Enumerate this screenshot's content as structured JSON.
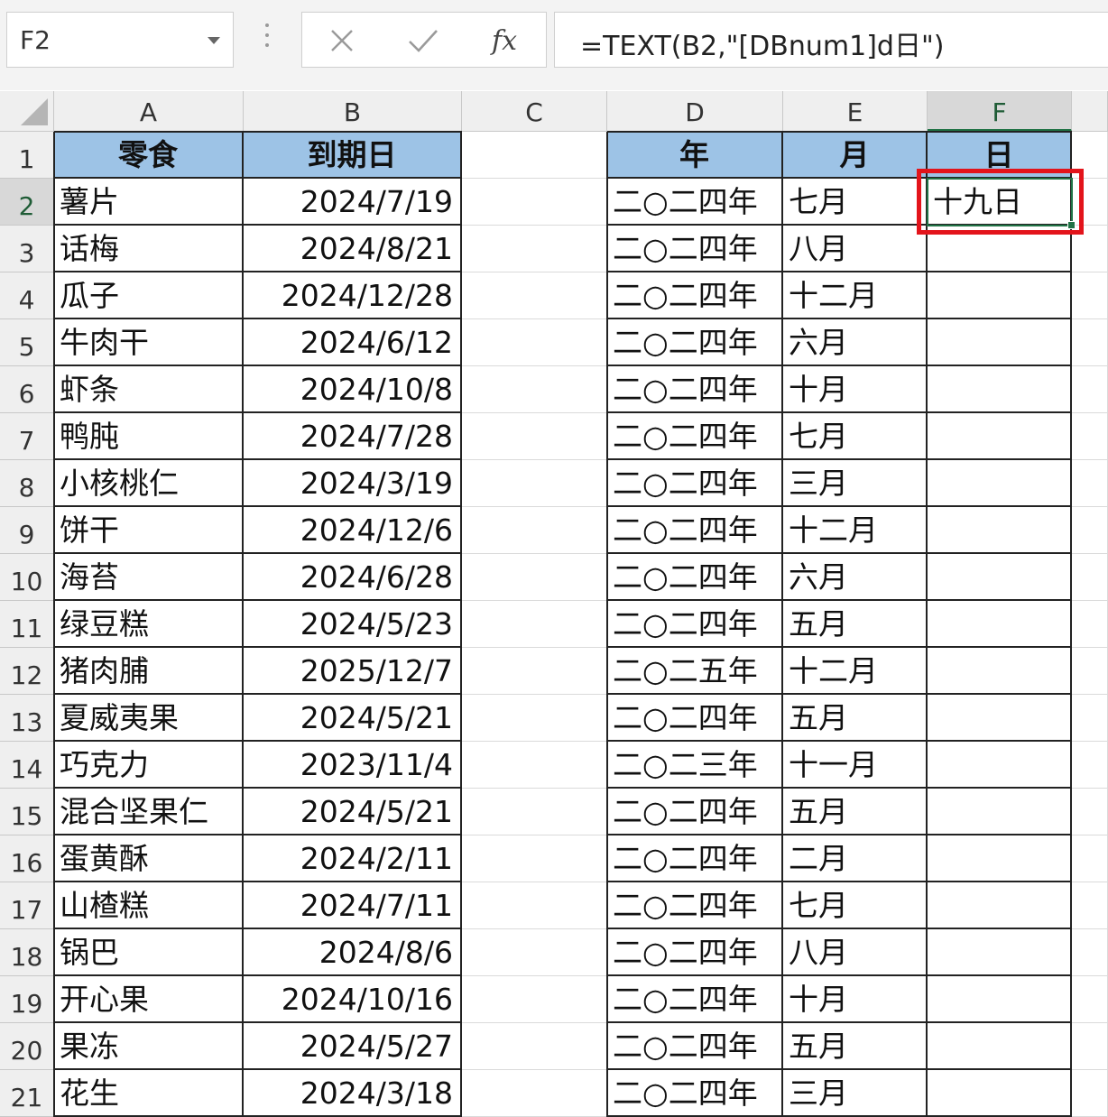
{
  "formula_bar": {
    "name_box": "F2",
    "cancel_icon": "close-icon",
    "enter_icon": "checkmark-icon",
    "fx_label": "fx",
    "formula": "=TEXT(B2,\"[DBnum1]d日\")"
  },
  "columns": [
    "A",
    "B",
    "C",
    "D",
    "E",
    "F"
  ],
  "selected_column": "F",
  "selected_row": "2",
  "rows": [
    "1",
    "2",
    "3",
    "4",
    "5",
    "6",
    "7",
    "8",
    "9",
    "10",
    "11",
    "12",
    "13",
    "14",
    "15",
    "16",
    "17",
    "18",
    "19",
    "20",
    "21"
  ],
  "headers": {
    "A": "零食",
    "B": "到期日",
    "D": "年",
    "E": "月",
    "F": "日"
  },
  "data": [
    {
      "a": "薯片",
      "b": "2024/7/19",
      "d": "二○二四年",
      "e": "七月",
      "f": "十九日"
    },
    {
      "a": "话梅",
      "b": "2024/8/21",
      "d": "二○二四年",
      "e": "八月",
      "f": ""
    },
    {
      "a": "瓜子",
      "b": "2024/12/28",
      "d": "二○二四年",
      "e": "十二月",
      "f": ""
    },
    {
      "a": "牛肉干",
      "b": "2024/6/12",
      "d": "二○二四年",
      "e": "六月",
      "f": ""
    },
    {
      "a": "虾条",
      "b": "2024/10/8",
      "d": "二○二四年",
      "e": "十月",
      "f": ""
    },
    {
      "a": "鸭肫",
      "b": "2024/7/28",
      "d": "二○二四年",
      "e": "七月",
      "f": ""
    },
    {
      "a": "小核桃仁",
      "b": "2024/3/19",
      "d": "二○二四年",
      "e": "三月",
      "f": ""
    },
    {
      "a": "饼干",
      "b": "2024/12/6",
      "d": "二○二四年",
      "e": "十二月",
      "f": ""
    },
    {
      "a": "海苔",
      "b": "2024/6/28",
      "d": "二○二四年",
      "e": "六月",
      "f": ""
    },
    {
      "a": "绿豆糕",
      "b": "2024/5/23",
      "d": "二○二四年",
      "e": "五月",
      "f": ""
    },
    {
      "a": "猪肉脯",
      "b": "2025/12/7",
      "d": "二○二五年",
      "e": "十二月",
      "f": ""
    },
    {
      "a": "夏威夷果",
      "b": "2024/5/21",
      "d": "二○二四年",
      "e": "五月",
      "f": ""
    },
    {
      "a": "巧克力",
      "b": "2023/11/4",
      "d": "二○二三年",
      "e": "十一月",
      "f": ""
    },
    {
      "a": "混合坚果仁",
      "b": "2024/5/21",
      "d": "二○二四年",
      "e": "五月",
      "f": ""
    },
    {
      "a": "蛋黄酥",
      "b": "2024/2/11",
      "d": "二○二四年",
      "e": "二月",
      "f": ""
    },
    {
      "a": "山楂糕",
      "b": "2024/7/11",
      "d": "二○二四年",
      "e": "七月",
      "f": ""
    },
    {
      "a": "锅巴",
      "b": "2024/8/6",
      "d": "二○二四年",
      "e": "八月",
      "f": ""
    },
    {
      "a": "开心果",
      "b": "2024/10/16",
      "d": "二○二四年",
      "e": "十月",
      "f": ""
    },
    {
      "a": "果冻",
      "b": "2024/5/27",
      "d": "二○二四年",
      "e": "五月",
      "f": ""
    },
    {
      "a": "花生",
      "b": "2024/3/18",
      "d": "二○二四年",
      "e": "三月",
      "f": ""
    }
  ],
  "colors": {
    "header_fill": "#9dc3e6",
    "selection": "#217346",
    "highlight": "#e3141b"
  }
}
